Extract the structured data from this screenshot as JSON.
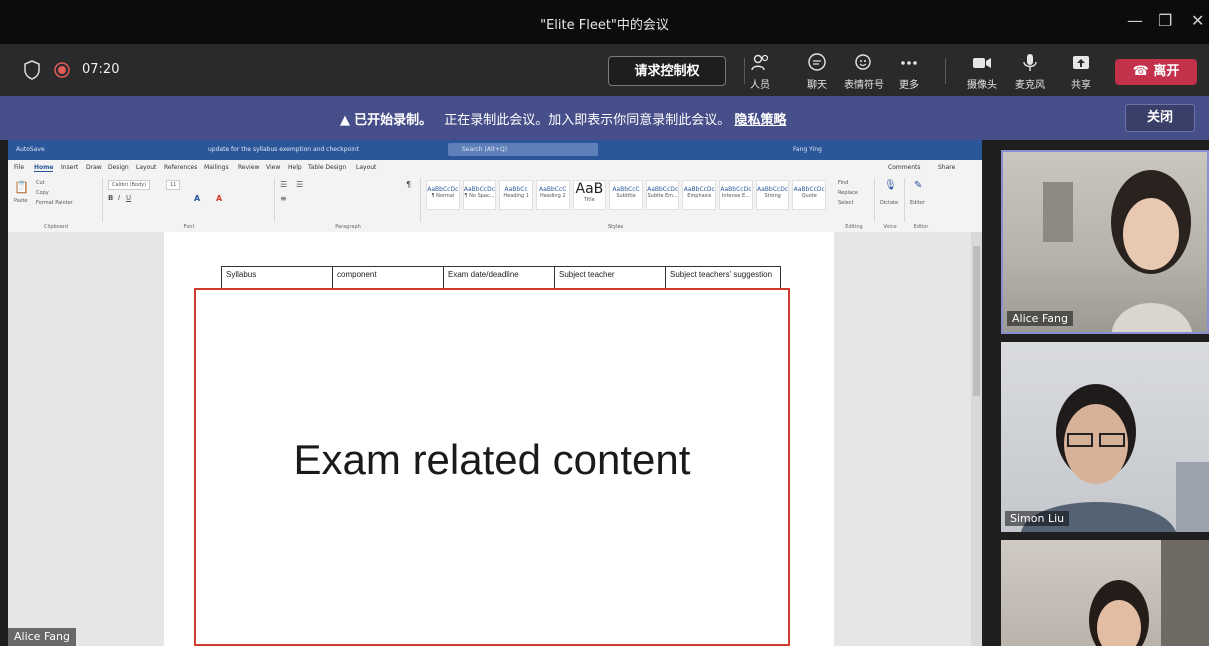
{
  "window": {
    "title": "\"Elite Fleet\"中的会议",
    "minimize": "—",
    "maximize": "❐",
    "close": "✕"
  },
  "meeting": {
    "timer": "07:20",
    "request_control": "请求控制权",
    "tools": [
      {
        "label": "人员",
        "icon": "people-icon"
      },
      {
        "label": "聊天",
        "icon": "chat-icon"
      },
      {
        "label": "表情符号",
        "icon": "emoji-icon"
      },
      {
        "label": "更多",
        "icon": "more-icon"
      },
      {
        "label": "摄像头",
        "icon": "camera-icon"
      },
      {
        "label": "麦克风",
        "icon": "microphone-icon"
      },
      {
        "label": "共享",
        "icon": "share-icon"
      }
    ],
    "leave": "离开"
  },
  "banner": {
    "bold": "已开始录制。",
    "text": "正在录制此会议。加入即表示你同意录制此会议。",
    "link": "隐私策略",
    "close": "关闭"
  },
  "word": {
    "autosave": "AutoSave",
    "filename": "update for the syllabus exemption and checkpoint",
    "search": "Search (Alt+Q)",
    "user": "Fang Ying",
    "menu": [
      "File",
      "Home",
      "Insert",
      "Draw",
      "Design",
      "Layout",
      "References",
      "Mailings",
      "Review",
      "View",
      "Help",
      "Table Design",
      "Layout"
    ],
    "comments": "Comments",
    "share": "Share",
    "groups": [
      "Clipboard",
      "Font",
      "Paragraph",
      "Styles",
      "Editing",
      "Voice",
      "Editor"
    ],
    "clipboard": {
      "paste": "Paste",
      "cut": "Cut",
      "copy": "Copy",
      "format_painter": "Format Painter"
    },
    "font": {
      "family": "Calibri (Body)",
      "size": "11"
    },
    "styles": [
      {
        "preview": "AaBbCcDc",
        "name": "¶ Normal"
      },
      {
        "preview": "AaBbCcDc",
        "name": "¶ No Spac..."
      },
      {
        "preview": "AaBbCc",
        "name": "Heading 1"
      },
      {
        "preview": "AaBbCcC",
        "name": "Heading 2"
      },
      {
        "preview": "AaB",
        "name": "Title"
      },
      {
        "preview": "AaBbCcC",
        "name": "Subtitle"
      },
      {
        "preview": "AaBbCcDc",
        "name": "Subtle Em..."
      },
      {
        "preview": "AaBbCcDc",
        "name": "Emphasis"
      },
      {
        "preview": "AaBbCcDc",
        "name": "Intense E..."
      },
      {
        "preview": "AaBbCcDc",
        "name": "Strong"
      },
      {
        "preview": "AaBbCcDc",
        "name": "Quote"
      }
    ],
    "editing": {
      "find": "Find",
      "replace": "Replace",
      "select": "Select"
    },
    "voice": "Dictate",
    "editor": "Editor",
    "table_headers": [
      "Syllabus",
      "component",
      "Exam date/deadline",
      "Subject teacher",
      "Subject teachers' suggestion"
    ],
    "overlay_text": "Exam related content"
  },
  "presenter_name": "Alice Fang",
  "participants": [
    {
      "name": "Alice Fang"
    },
    {
      "name": "Simon Liu"
    },
    {
      "name": ""
    }
  ]
}
